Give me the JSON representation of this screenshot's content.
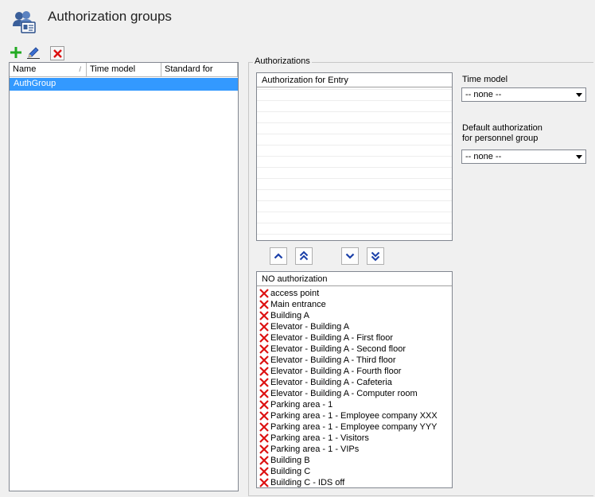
{
  "header": {
    "title": "Authorization groups",
    "icon": "users-card-icon"
  },
  "toolbar": {
    "add_icon": "plus-icon",
    "edit_icon": "pencil-icon",
    "delete_icon": "close-icon"
  },
  "groups_table": {
    "columns": [
      {
        "label": "Name",
        "sort_indicator": "/"
      },
      {
        "label": "Time model"
      },
      {
        "label": "Standard for"
      }
    ],
    "rows": [
      {
        "name": "AuthGroup",
        "time_model": "",
        "standard_for": ""
      }
    ]
  },
  "authorizations": {
    "group_title": "Authorizations",
    "entry_list_header": "Authorization for Entry",
    "entry_items": [],
    "arrows": [
      "move-up-icon",
      "move-all-up-icon",
      "move-down-icon",
      "move-all-down-icon"
    ],
    "no_list_header": "NO authorization",
    "no_items": [
      "access point",
      "Main entrance",
      "Building A",
      "Elevator - Building A",
      "Elevator - Building A - First floor",
      "Elevator - Building A - Second floor",
      "Elevator - Building A - Third floor",
      "Elevator - Building A - Fourth floor",
      "Elevator - Building A - Cafeteria",
      "Elevator - Building A - Computer room",
      "Parking area - 1",
      "Parking area - 1 - Employee company XXX",
      "Parking area - 1 - Employee company YYY",
      "Parking area - 1 - Visitors",
      "Parking area - 1 - VIPs",
      "Building B",
      "Building C",
      "Building C - IDS off"
    ]
  },
  "time_model": {
    "label": "Time model",
    "value": "-- none --"
  },
  "default_auth": {
    "label_line1": "Default authorization",
    "label_line2": "for personnel group",
    "value": "-- none --"
  },
  "colors": {
    "selection": "#3399ff",
    "add": "#22aa22",
    "delete": "#dd1111",
    "arrow": "#1a3fa8"
  }
}
